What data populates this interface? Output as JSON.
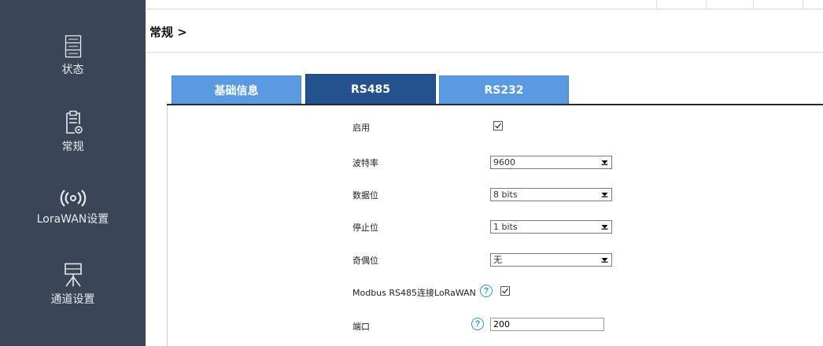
{
  "sidebar": {
    "items": [
      {
        "label": "状态",
        "icon": "server-status-icon"
      },
      {
        "label": "常规",
        "icon": "clipboard-gear-icon"
      },
      {
        "label": "LoraWAN设置",
        "icon": "wireless-signal-icon"
      },
      {
        "label": "通道设置",
        "icon": "network-channel-icon"
      }
    ]
  },
  "breadcrumb": "常规 >",
  "tabs": [
    {
      "label": "基础信息",
      "active": false
    },
    {
      "label": "RS485",
      "active": true
    },
    {
      "label": "RS232",
      "active": false
    }
  ],
  "form": {
    "enable": {
      "label": "启用",
      "checked": true
    },
    "baud_rate": {
      "label": "波特率",
      "value": "9600"
    },
    "data_bits": {
      "label": "数据位",
      "value": "8 bits"
    },
    "stop_bits": {
      "label": "停止位",
      "value": "1 bits"
    },
    "parity": {
      "label": "奇偶位",
      "value": "无"
    },
    "modbus": {
      "label": "Modbus RS485连接LoRaWAN",
      "help": "?",
      "checked": true
    },
    "port": {
      "label": "端口",
      "help": "?",
      "value": "200"
    }
  },
  "colors": {
    "sidebar_bg": "#3a4557",
    "tab_inactive": "#5a9ae1",
    "tab_active": "#23528f",
    "help_icon": "#2f95d7"
  }
}
